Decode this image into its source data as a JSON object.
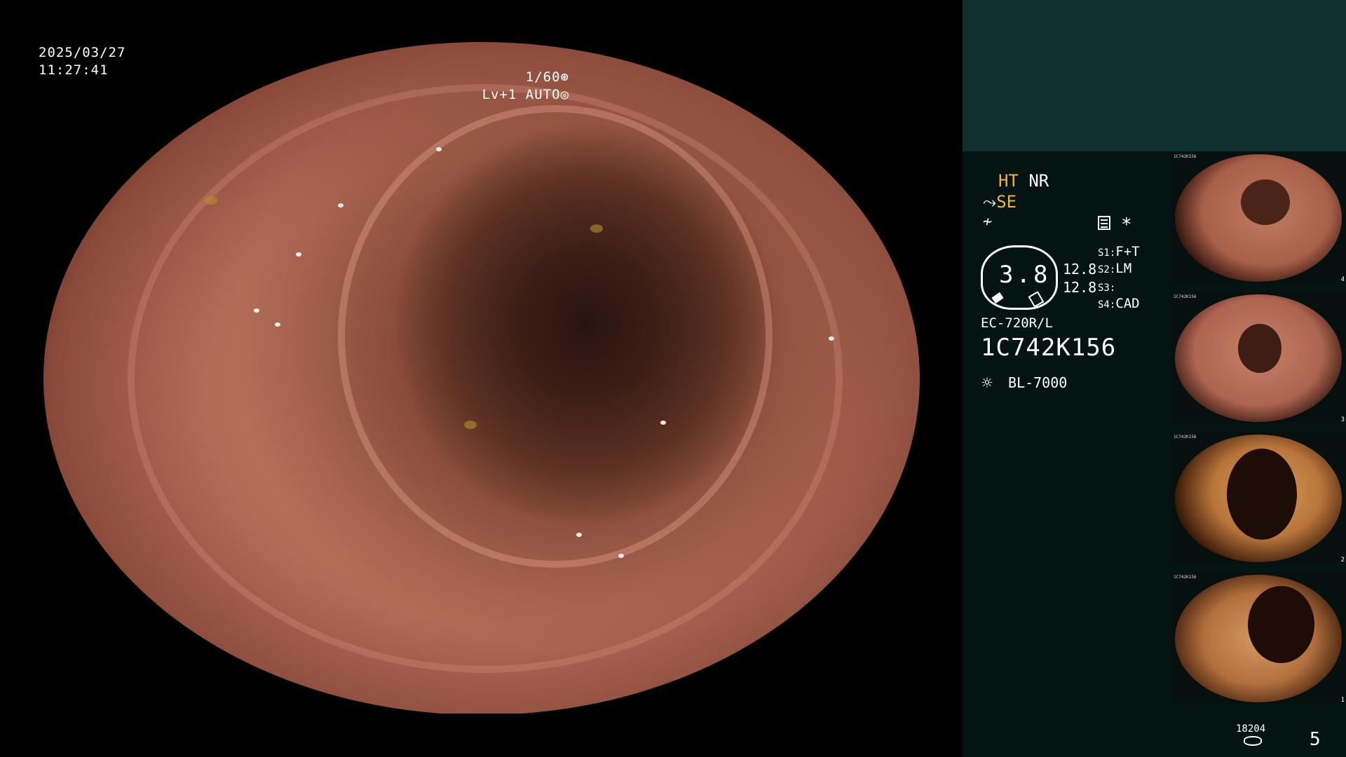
{
  "osd": {
    "date": "2025/03/27",
    "time": "11:27:41",
    "shutter": "1/60",
    "iris": "Lv+1 AUTO",
    "shutter_icon": "aperture-icon",
    "auto_icon": "iris-icon"
  },
  "panel": {
    "mode_line1": {
      "a": "HT",
      "b": "NR"
    },
    "mode_line2": "SE",
    "mode_line3": "≁",
    "menu_icon": "menu-list-icon",
    "asterisk": "*",
    "dial_value": "3.8",
    "enhancement": [
      "12.8",
      "12.8"
    ],
    "switches": [
      {
        "key": "S1",
        "val": "F+T"
      },
      {
        "key": "S2",
        "val": "LM"
      },
      {
        "key": "S3",
        "val": ""
      },
      {
        "key": "S4",
        "val": "CAD"
      }
    ],
    "scope_model": "EC-720R/L",
    "scope_serial": "1C742K156",
    "light_icon": "sun-icon",
    "light_source": "BL-7000",
    "image_counter": "18204",
    "page_number": "5"
  },
  "thumbnails": [
    {
      "num": "4",
      "serial": "1C742K156"
    },
    {
      "num": "3",
      "serial": "1C742K156"
    },
    {
      "num": "2",
      "serial": "1C742K156"
    },
    {
      "num": "1",
      "serial": "1C742K156"
    }
  ],
  "colors": {
    "panel_bg": "#041413",
    "panel_top": "#0f302e",
    "accent_yellow": "#f2b53a"
  }
}
